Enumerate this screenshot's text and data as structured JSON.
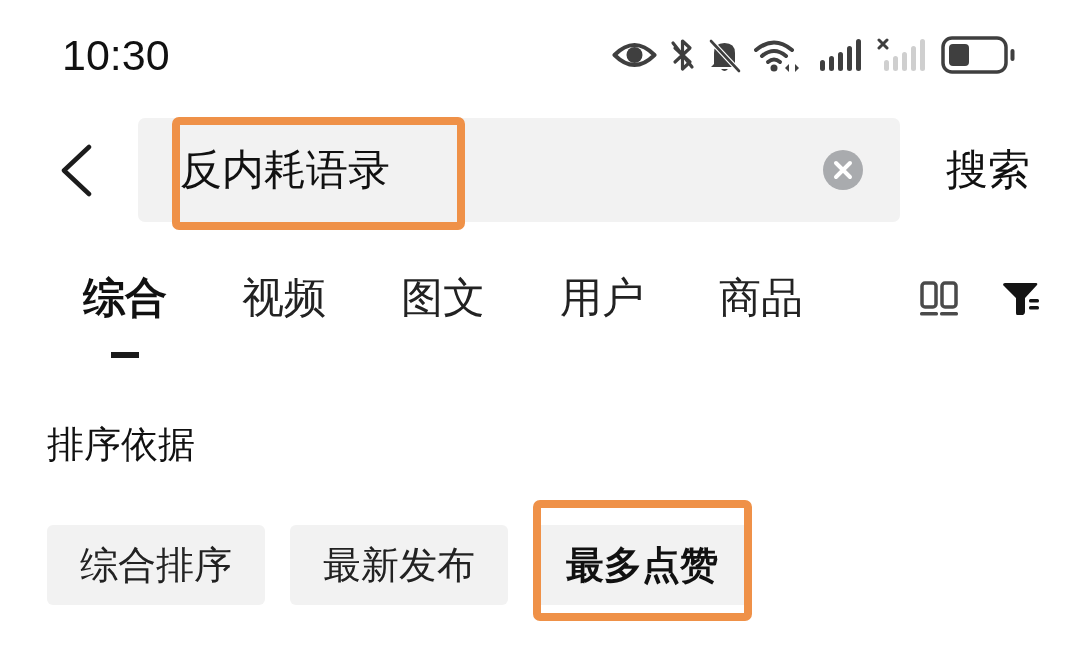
{
  "status_bar": {
    "time": "10:30"
  },
  "search": {
    "query": "反内耗语录",
    "highlighted": true,
    "button": "搜索"
  },
  "tabs": [
    {
      "label": "综合",
      "selected": true
    },
    {
      "label": "视频",
      "selected": false
    },
    {
      "label": "图文",
      "selected": false
    },
    {
      "label": "用户",
      "selected": false
    },
    {
      "label": "商品",
      "selected": false
    }
  ],
  "sort": {
    "heading": "排序依据",
    "options": [
      {
        "label": "综合排序",
        "selected": false,
        "highlighted": false
      },
      {
        "label": "最新发布",
        "selected": false,
        "highlighted": false
      },
      {
        "label": "最多点赞",
        "selected": true,
        "highlighted": true
      }
    ]
  }
}
